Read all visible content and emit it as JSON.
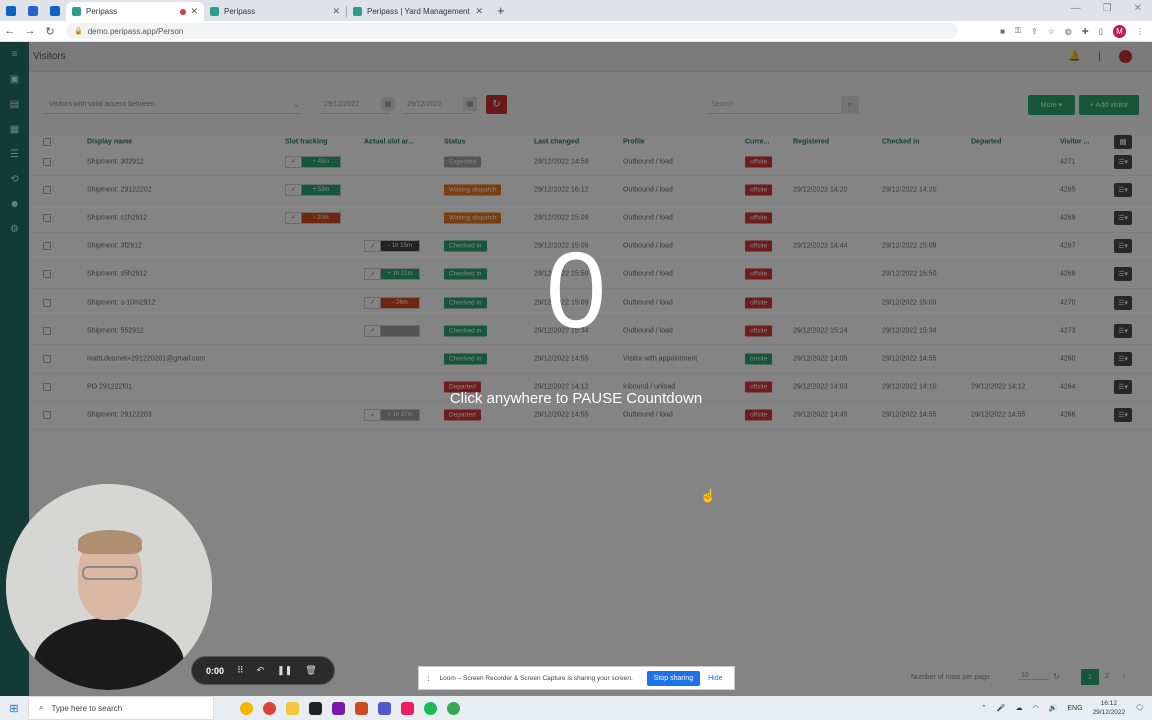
{
  "browser": {
    "tabs": [
      {
        "label": "Peripass",
        "active": true,
        "recording": true
      },
      {
        "label": "Peripass",
        "active": false
      },
      {
        "label": "Peripass | Yard Management",
        "active": false
      }
    ],
    "url": "demo.peripass.app/Person"
  },
  "app": {
    "page_title": "Visitors",
    "filter_placeholder": "Visitors with valid access between",
    "date_from": "29/12/2022",
    "date_to": "29/12/2022",
    "search_placeholder": "Search...",
    "more_label": "More",
    "add_visitor_label": "Add visitor",
    "columns": [
      "Display name",
      "Slot tracking",
      "Actual slot ar...",
      "Status",
      "Last changed",
      "Profile",
      "Curre...",
      "Registered",
      "Checked in",
      "Departed",
      "Visitor ..."
    ],
    "rows": [
      {
        "name": "Shipment: 302912",
        "slot": "+ 45m",
        "slot_color": "#23a36b",
        "actual": "",
        "status": "Expected",
        "status_color": "#9e9e9e",
        "last_changed": "29/12/2022 14:59",
        "profile": "Outbound / load",
        "current": "offsite",
        "current_color": "#d32f2f",
        "registered": "",
        "checked_in": "",
        "departed": "",
        "visitor": "4271"
      },
      {
        "name": "Shipment: 29122202",
        "slot": "+ 53m",
        "slot_color": "#23a36b",
        "actual": "",
        "status": "Waiting dispatch",
        "status_color": "#e8711a",
        "last_changed": "29/12/2022 16:12",
        "profile": "Outbound / load",
        "current": "offsite",
        "current_color": "#d32f2f",
        "registered": "29/12/2022 14:20",
        "checked_in": "29/12/2022 14:20",
        "departed": "",
        "visitor": "4265"
      },
      {
        "name": "Shipment: s1h2912",
        "slot": "- 20m",
        "slot_color": "#d84315",
        "actual": "",
        "status": "Waiting dispatch",
        "status_color": "#e8711a",
        "last_changed": "29/12/2022 15:09",
        "profile": "Outbound / load",
        "current": "offsite",
        "current_color": "#d32f2f",
        "registered": "",
        "checked_in": "",
        "departed": "",
        "visitor": "4269"
      },
      {
        "name": "Shipment: 3f2912",
        "slot": "",
        "actual": "- 1h 15m",
        "actual_color": "#3a3a3a",
        "status": "Checked in",
        "status_color": "#23a36b",
        "last_changed": "29/12/2022 15:09",
        "profile": "Outbound / load",
        "current": "offsite",
        "current_color": "#d32f2f",
        "registered": "29/12/2022 14:44",
        "checked_in": "29/12/2022 15:09",
        "departed": "",
        "visitor": "4267"
      },
      {
        "name": "Shipment: s5h2912",
        "slot": "",
        "actual": "+ 1h 21m",
        "actual_color": "#23a36b",
        "status": "Checked in",
        "status_color": "#23a36b",
        "last_changed": "29/12/2022 15:50",
        "profile": "Outbound / load",
        "current": "offsite",
        "current_color": "#d32f2f",
        "registered": "",
        "checked_in": "29/12/2022 15:50",
        "departed": "",
        "visitor": "4268"
      },
      {
        "name": "Shipment: s-10m2912",
        "slot": "",
        "actual": "- 26m",
        "actual_color": "#d84315",
        "status": "Checked in",
        "status_color": "#23a36b",
        "last_changed": "29/12/2022 15:09",
        "profile": "Outbound / load",
        "current": "offsite",
        "current_color": "#d32f2f",
        "registered": "",
        "checked_in": "29/12/2022 15:09",
        "departed": "",
        "visitor": "4270"
      },
      {
        "name": "Shipment: 552912",
        "slot": "",
        "actual": "",
        "actual_color": "#9e9e9e",
        "status": "Checked in",
        "status_color": "#23a36b",
        "last_changed": "29/12/2022 15:34",
        "profile": "Outbound / load",
        "current": "offsite",
        "current_color": "#d32f2f",
        "registered": "29/12/2022 15:24",
        "checked_in": "29/12/2022 15:34",
        "departed": "",
        "visitor": "4273"
      },
      {
        "name": "matti.desmet+291220201@gmail.com",
        "slot": "",
        "actual": "",
        "status": "Checked in",
        "status_color": "#23a36b",
        "last_changed": "29/12/2022 14:55",
        "profile": "Visitor with appointment",
        "current": "onsite",
        "current_color": "#23a36b",
        "registered": "29/12/2022 14:05",
        "checked_in": "29/12/2022 14:55",
        "departed": "",
        "visitor": "4260"
      },
      {
        "name": "PO 291222f01",
        "slot": "",
        "actual": "",
        "status": "Departed",
        "status_color": "#d32f2f",
        "last_changed": "29/12/2022 14:12",
        "profile": "Inbound / unload",
        "current": "offsite",
        "current_color": "#d32f2f",
        "registered": "29/12/2022 14:03",
        "checked_in": "29/12/2022 14:10",
        "departed": "29/12/2022 14:12",
        "visitor": "4264"
      },
      {
        "name": "Shipment: 29122203",
        "slot": "",
        "actual": "+ 1h 27m",
        "actual_color": "#9e9e9e",
        "status": "Departed",
        "status_color": "#d32f2f",
        "last_changed": "29/12/2022 14:55",
        "profile": "Outbound / load",
        "current": "offsite",
        "current_color": "#d32f2f",
        "registered": "29/12/2022 14:45",
        "checked_in": "29/12/2022 14:55",
        "departed": "29/12/2022 14:55",
        "visitor": "4266"
      }
    ],
    "footer_rows_label": "Number of rows per page",
    "footer_rows_value": "10",
    "pages": [
      "1",
      "2"
    ]
  },
  "overlay": {
    "countdown": "0",
    "message": "Click anywhere to PAUSE Countdown"
  },
  "recorder": {
    "time": "0:00"
  },
  "sharebar": {
    "text": "Loom – Screen Recorder & Screen Capture is sharing your screen.",
    "stop_label": "Stop sharing",
    "hide_label": "Hide"
  },
  "taskbar": {
    "search_placeholder": "Type here to search",
    "lang": "ENG",
    "time": "16:12",
    "date": "29/12/2022"
  }
}
